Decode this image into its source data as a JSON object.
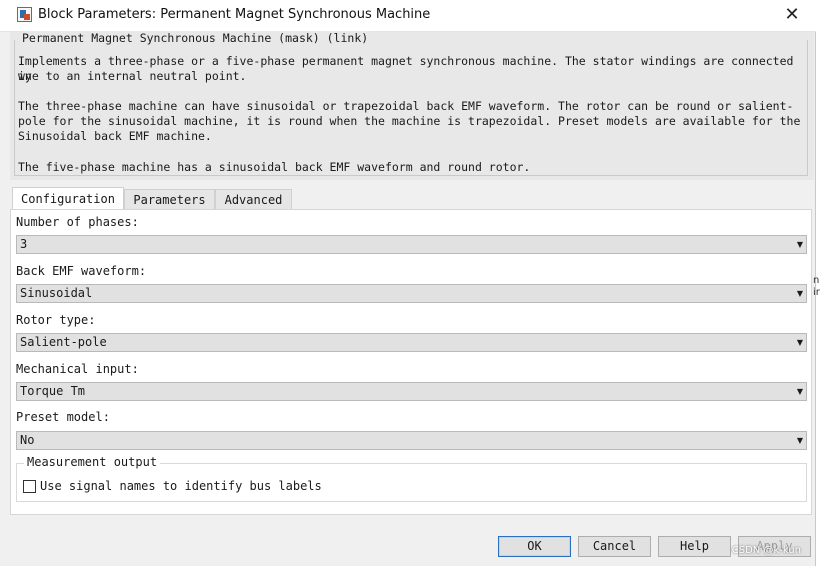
{
  "window": {
    "title": "Block Parameters: Permanent Magnet Synchronous Machine",
    "close_glyph": "✕"
  },
  "description": {
    "heading": "Permanent Magnet Synchronous Machine (mask) (link)",
    "para1_line1": "Implements a three-phase or a five-phase permanent magnet synchronous machine. The stator windings are connected in",
    "para1_line2": "wye to an internal neutral point.",
    "para2_line1": "The three-phase machine can have sinusoidal or trapezoidal back EMF waveform. The rotor can be round or salient-",
    "para2_line2": "pole for the sinusoidal machine, it is round when the machine is trapezoidal. Preset models are available for the",
    "para2_line3": "Sinusoidal back EMF machine.",
    "para3": "The five-phase machine has a sinusoidal back EMF waveform and round rotor."
  },
  "tabs": [
    {
      "label": "Configuration",
      "active": true
    },
    {
      "label": "Parameters",
      "active": false
    },
    {
      "label": "Advanced",
      "active": false
    }
  ],
  "fields": [
    {
      "label": "Number of phases:",
      "value": "3"
    },
    {
      "label": "Back EMF waveform:",
      "value": "Sinusoidal"
    },
    {
      "label": "Rotor type:",
      "value": "Salient-pole"
    },
    {
      "label": "Mechanical input:",
      "value": "Torque Tm"
    },
    {
      "label": "Preset model:",
      "value": "No"
    }
  ],
  "measurement": {
    "legend": "Measurement output",
    "checkbox_label": "Use signal names to identify bus labels",
    "checked": false
  },
  "buttons": {
    "ok": "OK",
    "cancel": "Cancel",
    "help": "Help",
    "apply": "Apply"
  },
  "watermark": "CSDN @k-kun",
  "icons": {
    "dropdown": "chevron-down-icon",
    "title": "simulink-block-icon",
    "close": "close-icon"
  },
  "colors": {
    "dialog_bg": "#f0f0f0",
    "description_bg": "#e8e8e8",
    "default_button_border": "#2a6fc2"
  }
}
